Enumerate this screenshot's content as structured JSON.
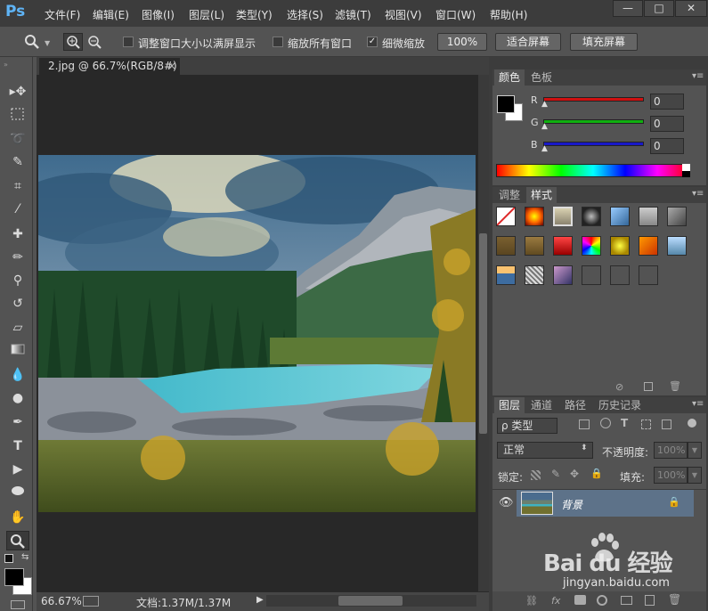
{
  "app": {
    "logo": "Ps"
  },
  "menu": [
    "文件(F)",
    "编辑(E)",
    "图像(I)",
    "图层(L)",
    "类型(Y)",
    "选择(S)",
    "滤镜(T)",
    "视图(V)",
    "窗口(W)",
    "帮助(H)"
  ],
  "window_controls": {
    "minimize": "—",
    "maximize": "□",
    "close": "✕"
  },
  "options": {
    "resize_windows": "调整窗口大小以满屏显示",
    "zoom_all": "缩放所有窗口",
    "scrubby_zoom": "细微缩放",
    "btn_100": "100%",
    "btn_fit": "适合屏幕",
    "btn_fill": "填充屏幕"
  },
  "document": {
    "tab_title": "2.jpg @ 66.7%(RGB/8#)",
    "close": "×"
  },
  "status": {
    "zoom": "66.67%",
    "doc": "文档:1.37M/1.37M"
  },
  "color_panel": {
    "tabs": [
      "颜色",
      "色板"
    ],
    "channels": [
      {
        "label": "R",
        "value": "0",
        "color": "#d01010"
      },
      {
        "label": "G",
        "value": "0",
        "color": "#10b010"
      },
      {
        "label": "B",
        "value": "0",
        "color": "#1818c8"
      }
    ]
  },
  "styles_panel": {
    "tabs": [
      "调整",
      "样式"
    ]
  },
  "layers_panel": {
    "tabs": [
      "图层",
      "通道",
      "路径",
      "历史记录"
    ],
    "filter": "ρ 类型",
    "blend_mode": "正常",
    "opacity_label": "不透明度:",
    "opacity_value": "100%",
    "lock_label": "锁定:",
    "fill_label": "填充:",
    "fill_value": "100%",
    "layer_name": "背景"
  },
  "watermark": {
    "brand": "Bai du 经验",
    "url": "jingyan.baidu.com"
  }
}
